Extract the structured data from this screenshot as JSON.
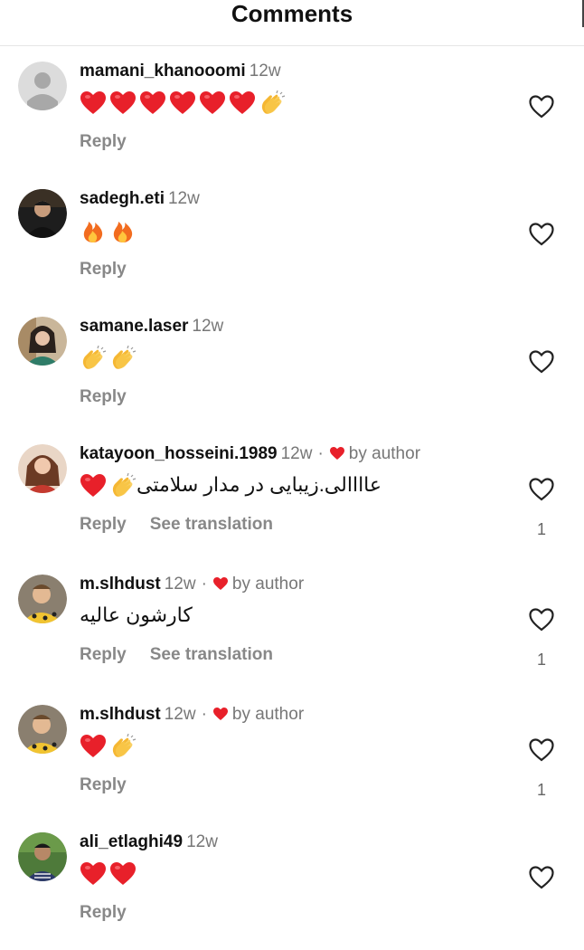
{
  "header": {
    "title": "Comments"
  },
  "colors": {
    "heart": "#e8202a",
    "muted": "#777777",
    "text": "#111111"
  },
  "comments": [
    {
      "username": "mamani_khanooomi",
      "time": "12w",
      "emojis": [
        "red-heart",
        "red-heart",
        "red-heart",
        "red-heart",
        "red-heart",
        "red-heart",
        "clapping-hands"
      ],
      "text": "",
      "reply": "Reply",
      "translation": "",
      "by_author": "",
      "likes": ""
    },
    {
      "username": "sadegh.eti",
      "time": "12w",
      "emojis": [
        "fire",
        "fire"
      ],
      "text": "",
      "reply": "Reply",
      "translation": "",
      "by_author": "",
      "likes": ""
    },
    {
      "username": "samane.laser",
      "time": "12w",
      "emojis": [
        "clapping-hands",
        "clapping-hands"
      ],
      "text": "",
      "reply": "Reply",
      "translation": "",
      "by_author": "",
      "likes": ""
    },
    {
      "username": "katayoon_hosseini.1989",
      "time": "12w",
      "emojis": [
        "red-heart",
        "clapping-hands"
      ],
      "text": "عاااالی.زیبایی در مدار سلامتی",
      "reply": "Reply",
      "translation": "See translation",
      "by_author": "by author",
      "likes": "1"
    },
    {
      "username": "m.slhdust",
      "time": "12w",
      "emojis": [],
      "text": "کارشون عالیه",
      "reply": "Reply",
      "translation": "See translation",
      "by_author": "by author",
      "likes": "1"
    },
    {
      "username": "m.slhdust",
      "time": "12w",
      "emojis": [
        "red-heart",
        "clapping-hands"
      ],
      "text": "",
      "reply": "Reply",
      "translation": "",
      "by_author": "by author",
      "likes": "1"
    },
    {
      "username": "ali_etlaghi49",
      "time": "12w",
      "emojis": [
        "red-heart",
        "red-heart"
      ],
      "text": "",
      "reply": "Reply",
      "translation": "",
      "by_author": "",
      "likes": ""
    }
  ]
}
